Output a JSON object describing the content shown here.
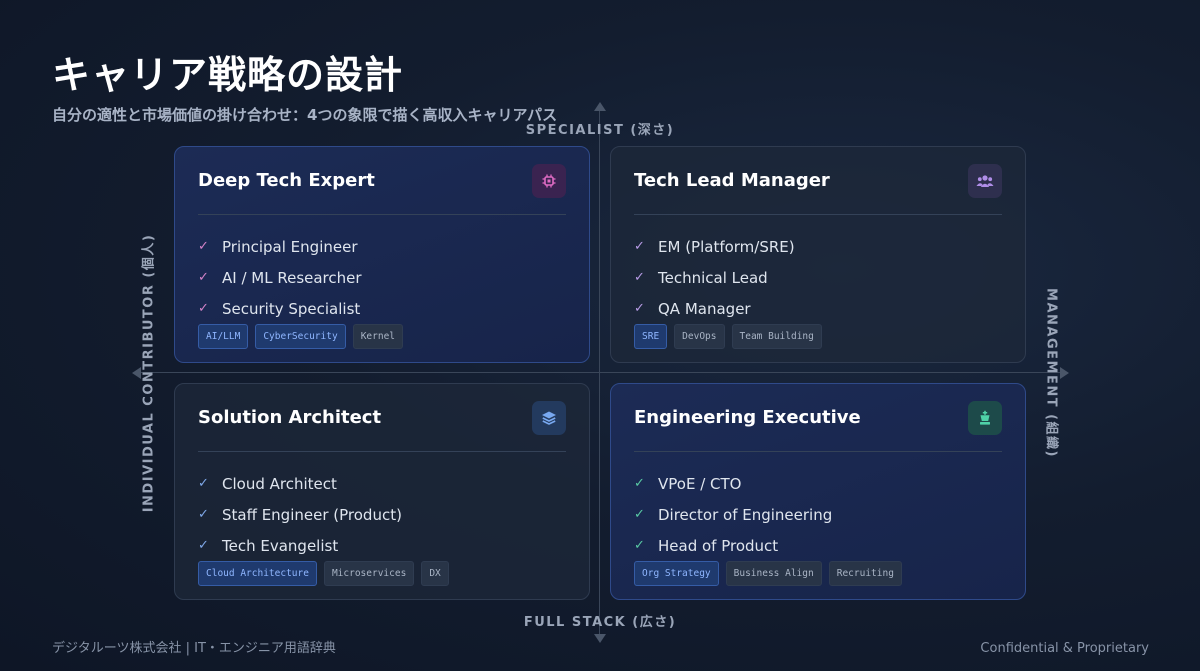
{
  "page": {
    "title": "キャリア戦略の設計",
    "subtitle": "自分の適性と市場価値の掛け合わせ：4つの象限で描く高収入キャリアパス"
  },
  "axes": {
    "top": "SPECIALIST (深さ)",
    "bottom": "FULL STACK (広さ)",
    "left": "INDIVIDUAL CONTRIBUTOR (個人)",
    "right": "MANAGEMENT (組織)"
  },
  "quadrants": [
    {
      "title": "Deep Tech Expert",
      "icon": "chip-icon",
      "icon_color": "#e06cc4",
      "check_color": "#d383c8",
      "items": [
        "Principal Engineer",
        "AI / ML Researcher",
        "Security Specialist"
      ],
      "tags": [
        "AI/LLM",
        "CyberSecurity",
        "Kernel"
      ]
    },
    {
      "title": "Tech Lead Manager",
      "icon": "team-icon",
      "icon_color": "#b08ee8",
      "check_color": "#b79be6",
      "items": [
        "EM (Platform/SRE)",
        "Technical Lead",
        "QA Manager"
      ],
      "tags": [
        "SRE",
        "DevOps",
        "Team Building"
      ]
    },
    {
      "title": "Solution Architect",
      "icon": "layers-icon",
      "icon_color": "#78a8f0",
      "check_color": "#7fa8e8",
      "items": [
        "Cloud Architect",
        "Staff Engineer (Product)",
        "Tech Evangelist"
      ],
      "tags": [
        "Cloud Architecture",
        "Microservices",
        "DX"
      ]
    },
    {
      "title": "Engineering Executive",
      "icon": "chess-icon",
      "icon_color": "#4fd1a8",
      "check_color": "#59c9a4",
      "items": [
        "VPoE / CTO",
        "Director of Engineering",
        "Head of Product"
      ],
      "tags": [
        "Org Strategy",
        "Business Align",
        "Recruiting"
      ]
    }
  ],
  "footer": {
    "left": "デジタルーツ株式会社 | IT・エンジニア用語辞典",
    "right": "Confidential & Proprietary"
  }
}
